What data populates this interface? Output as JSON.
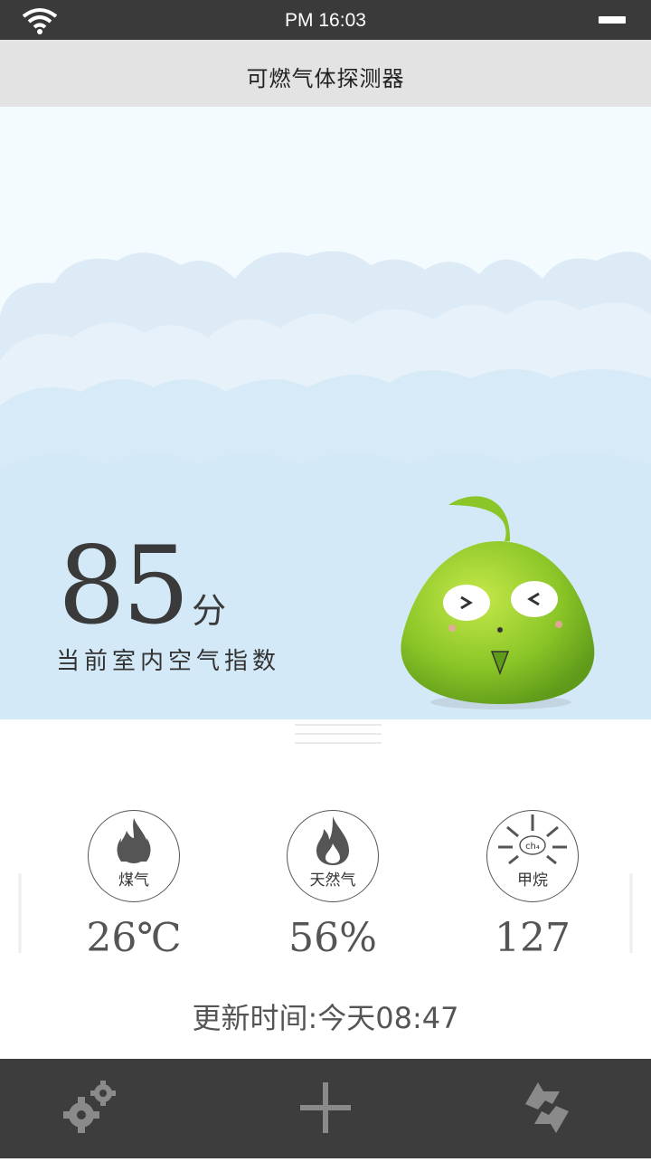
{
  "status_bar": {
    "time": "PM 16:03",
    "icons": [
      "wifi-icon",
      "battery-icon"
    ]
  },
  "header": {
    "title": "可燃气体探测器"
  },
  "score": {
    "value": "85",
    "unit": "分",
    "label": "当前室内空气指数"
  },
  "metrics": [
    {
      "icon": "gas-flame-icon",
      "name": "煤气",
      "value": "26℃"
    },
    {
      "icon": "natural-gas-flame-icon",
      "name": "天然气",
      "value": "56%"
    },
    {
      "icon": "methane-icon",
      "name": "甲烷",
      "icon_text": "ch₄",
      "value": "127"
    }
  ],
  "update": {
    "text": "更新时间:今天08:47"
  },
  "tab_bar": {
    "items": [
      "settings-gears-icon",
      "add-icon",
      "refresh-icon"
    ]
  },
  "colors": {
    "status_bar": "#3a3a3a",
    "title_bar": "#e3e3e3",
    "sky": "#f4fbfe",
    "cloud": "#d4e9f6",
    "mascot": "#8bc628",
    "tab_bar": "#3d3d3d",
    "tab_icon": "#8a8a8a"
  }
}
